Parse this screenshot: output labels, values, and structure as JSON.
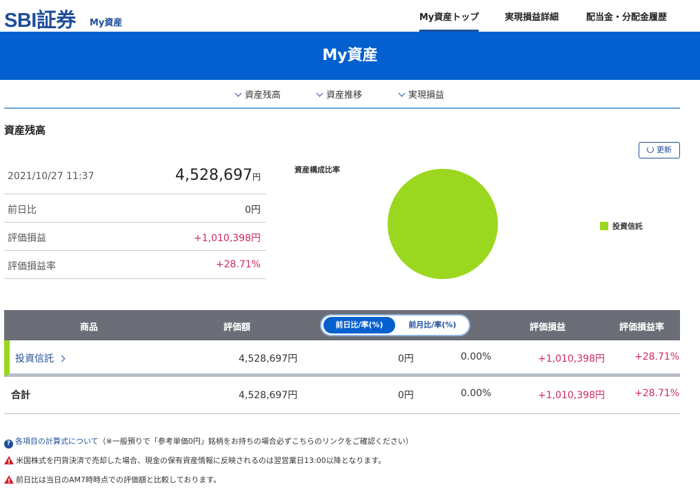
{
  "header": {
    "logo": "SBI証券",
    "logo_sub": "My資産",
    "nav": [
      "My資産トップ",
      "実現損益詳細",
      "配当金・分配金履歴"
    ]
  },
  "banner": {
    "title": "My資産"
  },
  "anchors": [
    "資産残高",
    "資産推移",
    "実現損益"
  ],
  "balance": {
    "section_title": "資産残高",
    "refresh_label": "更新",
    "datetime": "2021/10/27 11:37",
    "total": "4,528,697",
    "yen": "円",
    "rows": [
      {
        "label": "前日比",
        "value": "0円"
      },
      {
        "label": "評価損益",
        "value": "+1,010,398円"
      },
      {
        "label": "評価損益率",
        "value": "+28.71%"
      }
    ]
  },
  "composition": {
    "title": "資産構成比率",
    "legend": "投資信託",
    "color": "#9bd71f",
    "share": 1.0
  },
  "table": {
    "headers": {
      "product": "商品",
      "valuation": "評価額",
      "gain": "評価損益",
      "gain_rate": "評価損益率"
    },
    "toggle": {
      "day": "前日比/率(%)",
      "month": "前月比/率(%)"
    },
    "row": {
      "product": "投資信託",
      "valuation": "4,528,697円",
      "change": "0円",
      "change_rate": "0.00%",
      "gain": "+1,010,398円",
      "gain_rate": "+28.71%"
    },
    "total": {
      "label": "合計",
      "valuation": "4,528,697円",
      "change": "0円",
      "change_rate": "0.00%",
      "gain": "+1,010,398円",
      "gain_rate": "+28.71%"
    }
  },
  "notes": {
    "formula_link": "各項目の計算式について",
    "formula_note": "（※一般預りで「参考単価0円」銘柄をお持ちの場合必ずこちらのリンクをご確認ください）",
    "warn1": "米国株式を円貨決済で売却した場合、現金の保有資産情報に反映されるのは翌営業日13:00以降となります。",
    "warn2": "前日比は当日のAM7時時点での評価額と比較しております。"
  }
}
